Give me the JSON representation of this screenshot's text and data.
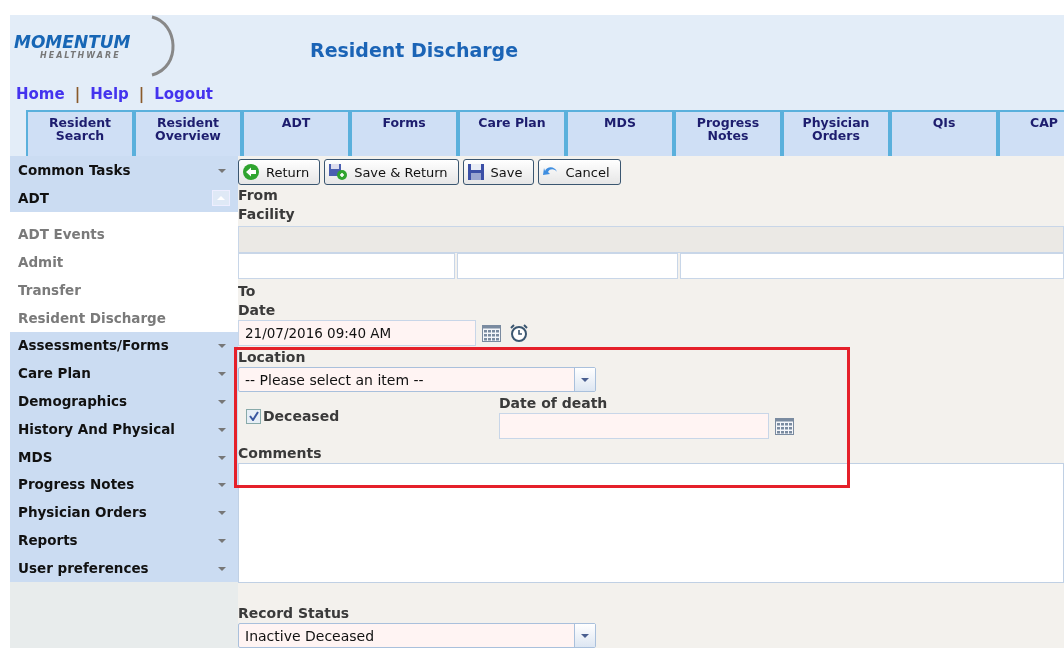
{
  "logo": {
    "name": "MOMENTUM",
    "tagline": "HEALTHWARE"
  },
  "page_title": "Resident Discharge",
  "top_links": [
    {
      "label": "Home"
    },
    {
      "label": "Help"
    },
    {
      "label": "Logout"
    }
  ],
  "link_separator": "|",
  "tabs": [
    {
      "label": "Resident Search"
    },
    {
      "label": "Resident Overview"
    },
    {
      "label": "ADT"
    },
    {
      "label": "Forms"
    },
    {
      "label": "Care Plan"
    },
    {
      "label": "MDS"
    },
    {
      "label": "Progress Notes"
    },
    {
      "label": "Physician Orders"
    },
    {
      "label": "QIs"
    },
    {
      "label": "CAP"
    }
  ],
  "sidebar": [
    {
      "label": "Common Tasks",
      "expanded": false
    },
    {
      "label": "ADT",
      "expanded": true,
      "children": [
        {
          "label": "ADT Events"
        },
        {
          "label": "Admit"
        },
        {
          "label": "Transfer"
        },
        {
          "label": "Resident Discharge"
        }
      ]
    },
    {
      "label": "Assessments/Forms",
      "expanded": false
    },
    {
      "label": "Care Plan",
      "expanded": false
    },
    {
      "label": "Demographics",
      "expanded": false
    },
    {
      "label": "History And Physical",
      "expanded": false
    },
    {
      "label": "MDS",
      "expanded": false
    },
    {
      "label": "Progress Notes",
      "expanded": false
    },
    {
      "label": "Physician Orders",
      "expanded": false
    },
    {
      "label": "Reports",
      "expanded": false
    },
    {
      "label": "User preferences",
      "expanded": false
    }
  ],
  "toolbar": [
    {
      "kind": "return",
      "label": "Return"
    },
    {
      "kind": "save-return",
      "label": "Save & Return"
    },
    {
      "kind": "save",
      "label": "Save"
    },
    {
      "kind": "cancel",
      "label": "Cancel"
    }
  ],
  "form": {
    "from_label": "From",
    "facility_label": "Facility",
    "to_label": "To",
    "date_label": "Date",
    "date_value": "21/07/2016 09:40 AM",
    "location_label": "Location",
    "location_placeholder": "-- Please select an item --",
    "deceased": {
      "label": "Deceased",
      "checked": true
    },
    "date_of_death_label": "Date of death",
    "comments_label": "Comments",
    "record_status_label": "Record Status",
    "record_status_value": "Inactive Deceased"
  }
}
